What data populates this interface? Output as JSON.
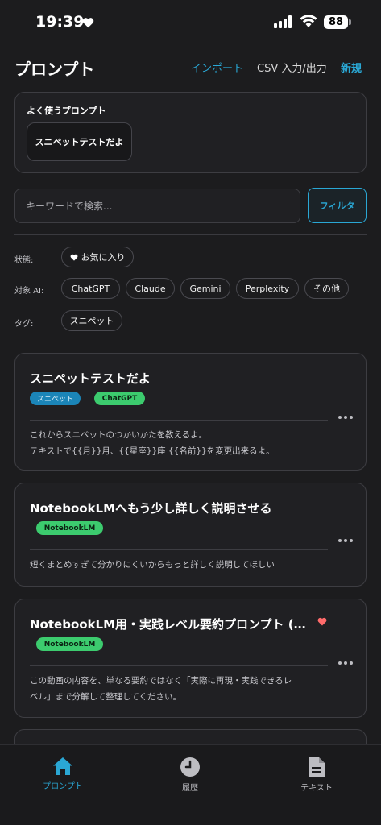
{
  "status_bar": {
    "time": "19:39",
    "battery": "88"
  },
  "header": {
    "title": "プロンプト",
    "import_label": "インポート",
    "csv_label": "CSV 入力/出力",
    "new_label": "新規"
  },
  "favorites": {
    "title": "よく使うプロンプト",
    "items": [
      "スニペットテストだよ"
    ]
  },
  "search": {
    "placeholder": "キーワードで検索...",
    "value": "",
    "filter_label": "フィルタ"
  },
  "filters": {
    "status_label": "状態:",
    "status_chip": "お気に入り",
    "ai_label": "対象 AI:",
    "ai_options": [
      "ChatGPT",
      "Claude",
      "Gemini",
      "Perplexity",
      "その他"
    ],
    "tag_label": "タグ:",
    "tag_options": [
      "スニペット"
    ]
  },
  "prompts": [
    {
      "title": "スニペットテストだよ",
      "tags": [
        "スニペット",
        "ChatGPT"
      ],
      "body_lines": [
        "これからスニペットのつかいかたを教えるよ。",
        "テキストで{{月}}月、{{星座}}座 {{名前}}を変更出来るよ。"
      ],
      "favorite": false
    },
    {
      "title": "NotebookLMへもう少し詳しく説明させる",
      "tags": [
        "NotebookLM"
      ],
      "body_lines": [
        "短くまとめすぎて分かりにくいからもっと詳しく説明してほしい"
      ],
      "favorite": false
    },
    {
      "title": "NotebookLM用・実践レベル要約プロンプト (完…",
      "tags": [
        "NotebookLM"
      ],
      "body_lines": [
        "この動画の内容を、単なる要約ではなく「実際に再現・実践できるレ",
        "ベル」まで分解して整理してください。"
      ],
      "favorite": true
    }
  ],
  "tab_bar": {
    "items": [
      {
        "label": "プロンプト",
        "icon": "home-icon",
        "active": true
      },
      {
        "label": "履歴",
        "icon": "clock-icon",
        "active": false
      },
      {
        "label": "テキスト",
        "icon": "document-icon",
        "active": false
      }
    ]
  },
  "colors": {
    "accent": "#2aa7d4",
    "background": "#1c1c1e",
    "card": "#202023",
    "tag_blue": "#1b85b8",
    "tag_green": "#3ccb6e",
    "favorite_heart": "#ff6b6b"
  }
}
